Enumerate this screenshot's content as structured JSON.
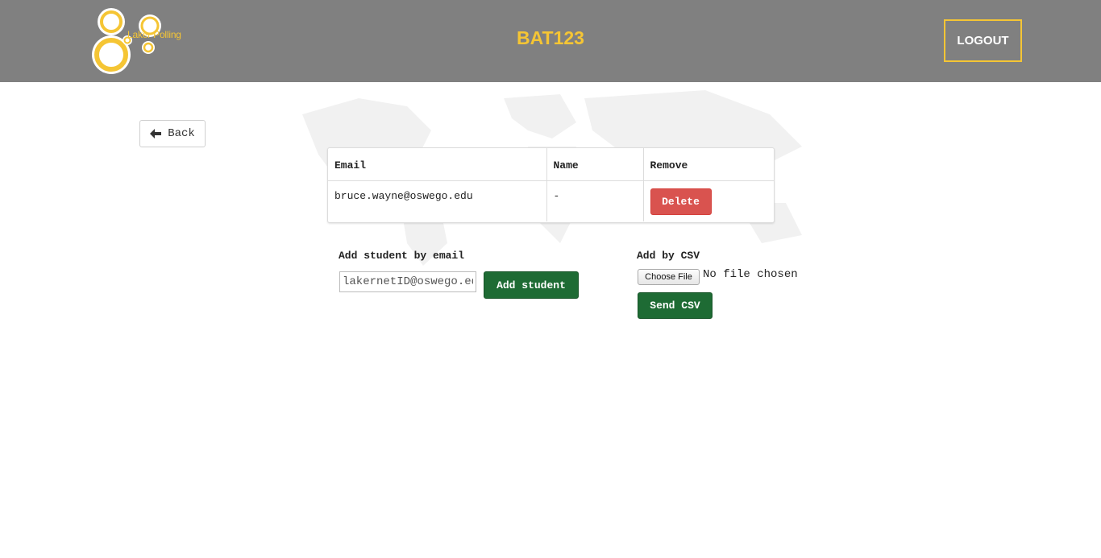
{
  "header": {
    "logo_text": "Laker Polling",
    "title": "BAT123",
    "logout_label": "LOGOUT",
    "accent_color": "#f5c534",
    "bg_color": "#808080"
  },
  "back_button": {
    "label": "Back",
    "icon": "arrow-left-icon"
  },
  "students_table": {
    "columns": [
      "Email",
      "Name",
      "Remove"
    ],
    "rows": [
      {
        "email": "bruce.wayne@oswego.edu",
        "name": "-",
        "action_label": "Delete"
      }
    ]
  },
  "add_by_email": {
    "label": "Add student by email",
    "placeholder": "lakernetID@oswego.edu",
    "button_label": "Add student"
  },
  "add_by_csv": {
    "label": "Add by CSV",
    "choose_file_label": "Choose File",
    "no_file_text": "No file chosen",
    "send_label": "Send CSV"
  }
}
